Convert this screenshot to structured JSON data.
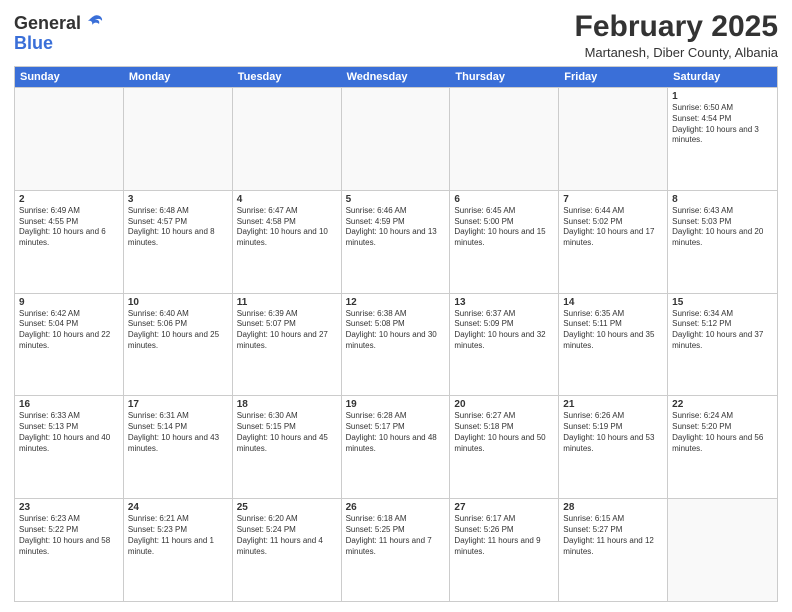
{
  "logo": {
    "general": "General",
    "blue": "Blue"
  },
  "header": {
    "month": "February 2025",
    "location": "Martanesh, Diber County, Albania"
  },
  "days_of_week": [
    "Sunday",
    "Monday",
    "Tuesday",
    "Wednesday",
    "Thursday",
    "Friday",
    "Saturday"
  ],
  "weeks": [
    [
      {
        "day": "",
        "empty": true
      },
      {
        "day": "",
        "empty": true
      },
      {
        "day": "",
        "empty": true
      },
      {
        "day": "",
        "empty": true
      },
      {
        "day": "",
        "empty": true
      },
      {
        "day": "",
        "empty": true
      },
      {
        "day": "1",
        "sunrise": "Sunrise: 6:50 AM",
        "sunset": "Sunset: 4:54 PM",
        "daylight": "Daylight: 10 hours and 3 minutes."
      }
    ],
    [
      {
        "day": "2",
        "sunrise": "Sunrise: 6:49 AM",
        "sunset": "Sunset: 4:55 PM",
        "daylight": "Daylight: 10 hours and 6 minutes."
      },
      {
        "day": "3",
        "sunrise": "Sunrise: 6:48 AM",
        "sunset": "Sunset: 4:57 PM",
        "daylight": "Daylight: 10 hours and 8 minutes."
      },
      {
        "day": "4",
        "sunrise": "Sunrise: 6:47 AM",
        "sunset": "Sunset: 4:58 PM",
        "daylight": "Daylight: 10 hours and 10 minutes."
      },
      {
        "day": "5",
        "sunrise": "Sunrise: 6:46 AM",
        "sunset": "Sunset: 4:59 PM",
        "daylight": "Daylight: 10 hours and 13 minutes."
      },
      {
        "day": "6",
        "sunrise": "Sunrise: 6:45 AM",
        "sunset": "Sunset: 5:00 PM",
        "daylight": "Daylight: 10 hours and 15 minutes."
      },
      {
        "day": "7",
        "sunrise": "Sunrise: 6:44 AM",
        "sunset": "Sunset: 5:02 PM",
        "daylight": "Daylight: 10 hours and 17 minutes."
      },
      {
        "day": "8",
        "sunrise": "Sunrise: 6:43 AM",
        "sunset": "Sunset: 5:03 PM",
        "daylight": "Daylight: 10 hours and 20 minutes."
      }
    ],
    [
      {
        "day": "9",
        "sunrise": "Sunrise: 6:42 AM",
        "sunset": "Sunset: 5:04 PM",
        "daylight": "Daylight: 10 hours and 22 minutes."
      },
      {
        "day": "10",
        "sunrise": "Sunrise: 6:40 AM",
        "sunset": "Sunset: 5:06 PM",
        "daylight": "Daylight: 10 hours and 25 minutes."
      },
      {
        "day": "11",
        "sunrise": "Sunrise: 6:39 AM",
        "sunset": "Sunset: 5:07 PM",
        "daylight": "Daylight: 10 hours and 27 minutes."
      },
      {
        "day": "12",
        "sunrise": "Sunrise: 6:38 AM",
        "sunset": "Sunset: 5:08 PM",
        "daylight": "Daylight: 10 hours and 30 minutes."
      },
      {
        "day": "13",
        "sunrise": "Sunrise: 6:37 AM",
        "sunset": "Sunset: 5:09 PM",
        "daylight": "Daylight: 10 hours and 32 minutes."
      },
      {
        "day": "14",
        "sunrise": "Sunrise: 6:35 AM",
        "sunset": "Sunset: 5:11 PM",
        "daylight": "Daylight: 10 hours and 35 minutes."
      },
      {
        "day": "15",
        "sunrise": "Sunrise: 6:34 AM",
        "sunset": "Sunset: 5:12 PM",
        "daylight": "Daylight: 10 hours and 37 minutes."
      }
    ],
    [
      {
        "day": "16",
        "sunrise": "Sunrise: 6:33 AM",
        "sunset": "Sunset: 5:13 PM",
        "daylight": "Daylight: 10 hours and 40 minutes."
      },
      {
        "day": "17",
        "sunrise": "Sunrise: 6:31 AM",
        "sunset": "Sunset: 5:14 PM",
        "daylight": "Daylight: 10 hours and 43 minutes."
      },
      {
        "day": "18",
        "sunrise": "Sunrise: 6:30 AM",
        "sunset": "Sunset: 5:15 PM",
        "daylight": "Daylight: 10 hours and 45 minutes."
      },
      {
        "day": "19",
        "sunrise": "Sunrise: 6:28 AM",
        "sunset": "Sunset: 5:17 PM",
        "daylight": "Daylight: 10 hours and 48 minutes."
      },
      {
        "day": "20",
        "sunrise": "Sunrise: 6:27 AM",
        "sunset": "Sunset: 5:18 PM",
        "daylight": "Daylight: 10 hours and 50 minutes."
      },
      {
        "day": "21",
        "sunrise": "Sunrise: 6:26 AM",
        "sunset": "Sunset: 5:19 PM",
        "daylight": "Daylight: 10 hours and 53 minutes."
      },
      {
        "day": "22",
        "sunrise": "Sunrise: 6:24 AM",
        "sunset": "Sunset: 5:20 PM",
        "daylight": "Daylight: 10 hours and 56 minutes."
      }
    ],
    [
      {
        "day": "23",
        "sunrise": "Sunrise: 6:23 AM",
        "sunset": "Sunset: 5:22 PM",
        "daylight": "Daylight: 10 hours and 58 minutes."
      },
      {
        "day": "24",
        "sunrise": "Sunrise: 6:21 AM",
        "sunset": "Sunset: 5:23 PM",
        "daylight": "Daylight: 11 hours and 1 minute."
      },
      {
        "day": "25",
        "sunrise": "Sunrise: 6:20 AM",
        "sunset": "Sunset: 5:24 PM",
        "daylight": "Daylight: 11 hours and 4 minutes."
      },
      {
        "day": "26",
        "sunrise": "Sunrise: 6:18 AM",
        "sunset": "Sunset: 5:25 PM",
        "daylight": "Daylight: 11 hours and 7 minutes."
      },
      {
        "day": "27",
        "sunrise": "Sunrise: 6:17 AM",
        "sunset": "Sunset: 5:26 PM",
        "daylight": "Daylight: 11 hours and 9 minutes."
      },
      {
        "day": "28",
        "sunrise": "Sunrise: 6:15 AM",
        "sunset": "Sunset: 5:27 PM",
        "daylight": "Daylight: 11 hours and 12 minutes."
      },
      {
        "day": "",
        "empty": true
      }
    ]
  ]
}
